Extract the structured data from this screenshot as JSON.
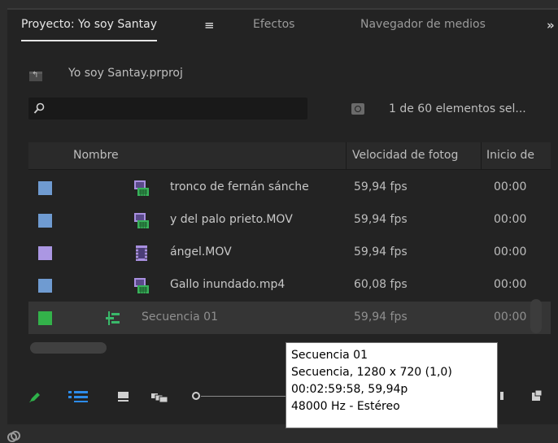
{
  "tabs": {
    "project": "Proyecto: Yo soy Santay",
    "menu_icon": "hamburger-menu-icon",
    "effects": "Efectos",
    "media_browser": "Navegador de medios",
    "more": "»"
  },
  "project": {
    "file": "Yo soy Santay.prproj"
  },
  "search": {
    "value": "",
    "placeholder": "",
    "count": "1 de 60 elementos sel..."
  },
  "table": {
    "headers": [
      "Nombre",
      "Velocidad de fotog",
      "Inicio de"
    ],
    "rows": [
      {
        "color": "#6f9bd1",
        "icon": "video-audio-clip-icon",
        "name": "tronco de fernán sánche",
        "fps": "59,94 fps",
        "start": "00:00",
        "selected": false
      },
      {
        "color": "#6f9bd1",
        "icon": "video-audio-clip-icon",
        "name": "y del palo prieto.MOV",
        "fps": "59,94 fps",
        "start": "00:00",
        "selected": false
      },
      {
        "color": "#ab97e3",
        "icon": "video-clip-icon",
        "name": "ángel.MOV",
        "fps": "59,94 fps",
        "start": "00:00",
        "selected": false
      },
      {
        "color": "#6f9bd1",
        "icon": "video-audio-clip-icon",
        "name": "Gallo inundado.mp4",
        "fps": "60,08 fps",
        "start": "00:00",
        "selected": false
      },
      {
        "color": "#33b24a",
        "icon": "sequence-icon",
        "name": "Secuencia 01",
        "fps": "59,94 fps",
        "start": "00:00",
        "selected": true
      }
    ]
  },
  "toolbar": {
    "icons": [
      "pencil-icon",
      "list-view-icon",
      "icon-view-icon",
      "freeform-view-icon",
      "zoom-slider",
      "sort-icons-icon",
      "new-item-icon"
    ]
  },
  "tooltip": {
    "lines": [
      "Secuencia 01",
      "Secuencia, 1280 x 720 (1,0)",
      "00:02:59:58, 59,94p",
      "48000 Hz - Estéreo"
    ]
  },
  "colors": {
    "panel_bg": "#232323",
    "accent_pencil": "#2fb24a",
    "list_icon_blue": "#2d8ceb"
  }
}
